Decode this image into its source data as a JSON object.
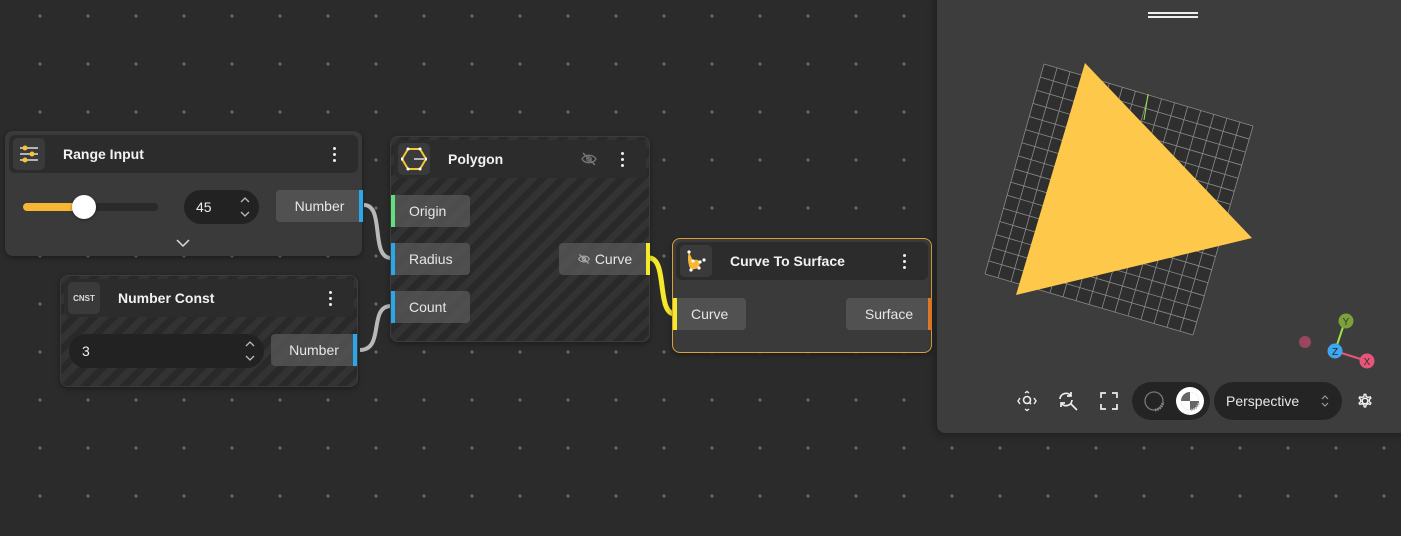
{
  "nodes": {
    "range_input": {
      "title": "Range Input",
      "icon": "sliders-icon",
      "value": "45",
      "slider_fraction": 0.45,
      "output_label": "Number",
      "output_color": "#2aa7e8"
    },
    "number_const": {
      "title": "Number Const",
      "icon_label": "CNST",
      "value": "3",
      "output_label": "Number",
      "output_color": "#2aa7e8",
      "state": "disabled"
    },
    "polygon": {
      "title": "Polygon",
      "icon": "hexagon-icon",
      "state": "disabled",
      "inputs": [
        {
          "label": "Origin",
          "color": "#5fe07a"
        },
        {
          "label": "Radius",
          "color": "#2aa7e8"
        },
        {
          "label": "Count",
          "color": "#2aa7e8"
        }
      ],
      "output": {
        "label": "Curve",
        "color": "#f5ea2a",
        "hidden": true
      }
    },
    "curve_to_surface": {
      "title": "Curve To Surface",
      "icon": "curve-surface-icon",
      "state": "selected",
      "inputs": [
        {
          "label": "Curve",
          "color": "#f5ea2a"
        }
      ],
      "output": {
        "label": "Surface",
        "color": "#e07a2a"
      }
    }
  },
  "viewport": {
    "camera_mode": "Perspective",
    "shading_modes": [
      "wireframe",
      "solid"
    ],
    "active_shading": "solid",
    "axes": {
      "x": "X",
      "y": "Y",
      "z": "Z"
    },
    "colors": {
      "surface": "#fec84b",
      "axis_x": "#e8557a",
      "axis_y": "#7ba23a",
      "axis_z": "#3da8f0"
    },
    "toolbar": [
      "focus-icon",
      "zoom-fit-icon",
      "fullscreen-icon",
      "settings-icon"
    ]
  },
  "accent_color": "#f7b733"
}
